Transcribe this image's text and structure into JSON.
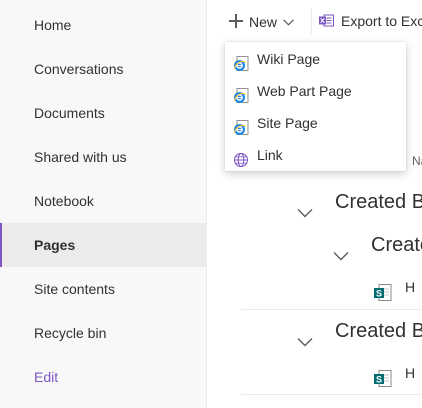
{
  "nav": {
    "items": [
      {
        "label": "Home"
      },
      {
        "label": "Conversations"
      },
      {
        "label": "Documents"
      },
      {
        "label": "Shared with us"
      },
      {
        "label": "Notebook"
      },
      {
        "label": "Pages",
        "selected": true
      },
      {
        "label": "Site contents"
      },
      {
        "label": "Recycle bin"
      }
    ],
    "edit_label": "Edit",
    "accent_color": "#7e57c2"
  },
  "commandbar": {
    "new_label": "New",
    "export_label": "Export to Exc"
  },
  "new_menu": {
    "items": [
      {
        "label": "Wiki Page",
        "icon": "ie-page-icon"
      },
      {
        "label": "Web Part Page",
        "icon": "ie-page-icon"
      },
      {
        "label": "Site Page",
        "icon": "ie-page-icon"
      },
      {
        "label": "Link",
        "icon": "globe-link-icon"
      }
    ]
  },
  "list": {
    "column_header_partial": "Na",
    "groups": [
      {
        "label": "Created B"
      },
      {
        "label": "Create"
      },
      {
        "label": "Created B"
      }
    ],
    "rows": [
      {
        "label": "H",
        "icon": "sharepoint-page-icon"
      },
      {
        "label": "H",
        "icon": "sharepoint-page-icon"
      }
    ]
  }
}
